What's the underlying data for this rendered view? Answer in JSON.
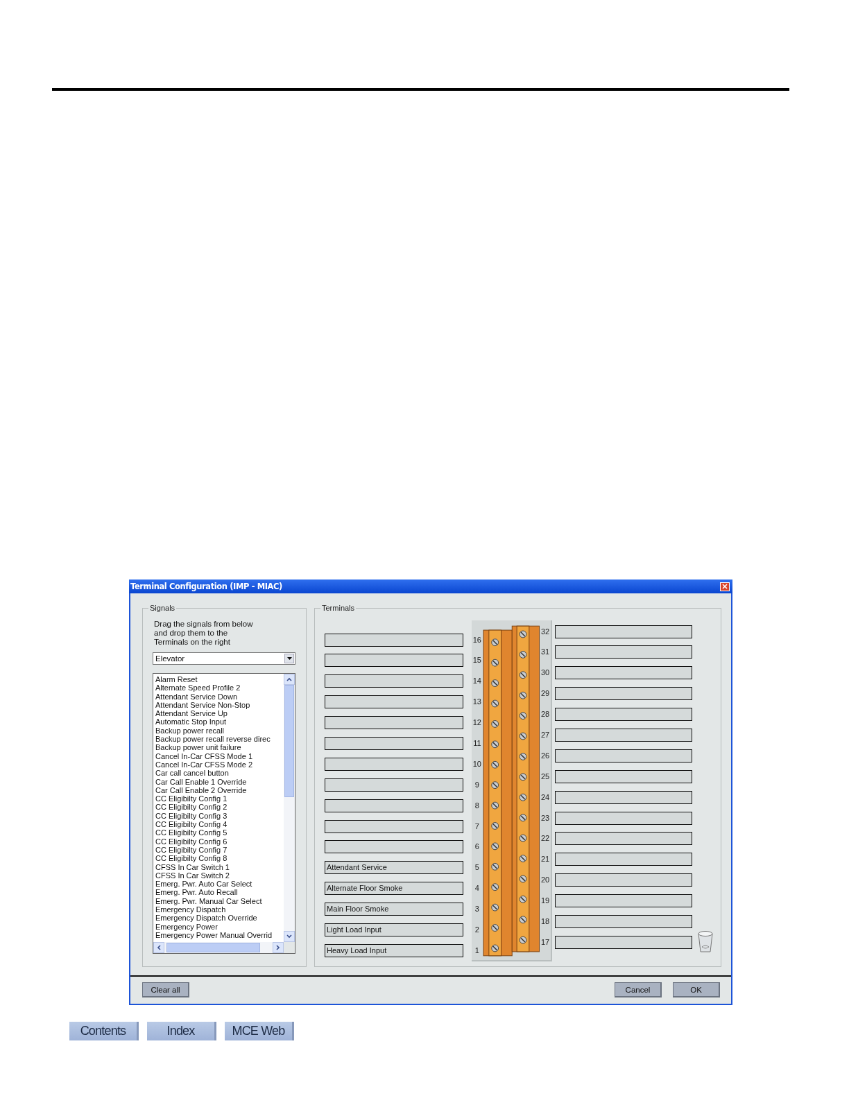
{
  "dialog": {
    "title": "Terminal Configuration (IMP - MIAC)",
    "signals": {
      "legend": "Signals",
      "instructions": "Drag the signals from below and drop them to the Terminals on the right",
      "category": "Elevator",
      "items": [
        "Alarm Reset",
        "Alternate Speed Profile 2",
        "Attendant Service Down",
        "Attendant Service Non-Stop",
        "Attendant Service Up",
        "Automatic Stop Input",
        "Backup power recall",
        "Backup power recall reverse direc",
        "Backup power unit failure",
        "Cancel In-Car CFSS Mode 1",
        "Cancel In-Car CFSS Mode 2",
        "Car call cancel button",
        "Car Call Enable 1 Override",
        "Car Call Enable 2 Override",
        "CC Eligibilty Config 1",
        "CC Eligibilty Config 2",
        "CC Eligibilty Config 3",
        "CC Eligibilty Config 4",
        "CC Eligibilty Config 5",
        "CC Eligibilty Config 6",
        "CC Eligibilty Config 7",
        "CC Eligibilty Config 8",
        "CFSS In Car Switch 1",
        "CFSS In Car Switch 2",
        "Emerg. Pwr. Auto Car Select",
        "Emerg. Pwr. Auto Recall",
        "Emerg. Pwr. Manual Car Select",
        "Emergency Dispatch",
        "Emergency Dispatch Override",
        "Emergency Power",
        "Emergency Power Manual Overrid"
      ]
    },
    "terminals": {
      "legend": "Terminals",
      "left": [
        {
          "number": "16"
        },
        {
          "number": "15"
        },
        {
          "number": "14"
        },
        {
          "number": "13"
        },
        {
          "number": "12"
        },
        {
          "number": "11"
        },
        {
          "number": "10"
        },
        {
          "number": "9"
        },
        {
          "number": "8"
        },
        {
          "number": "7"
        },
        {
          "number": "6"
        },
        {
          "number": "5",
          "signal": "Attendant Service"
        },
        {
          "number": "4",
          "signal": "Alternate Floor Smoke"
        },
        {
          "number": "3",
          "signal": "Main Floor Smoke"
        },
        {
          "number": "2",
          "signal": "Light Load Input"
        },
        {
          "number": "1",
          "signal": "Heavy Load Input"
        }
      ],
      "right": [
        {
          "number": "32"
        },
        {
          "number": "31"
        },
        {
          "number": "30"
        },
        {
          "number": "29"
        },
        {
          "number": "28"
        },
        {
          "number": "27"
        },
        {
          "number": "26"
        },
        {
          "number": "25"
        },
        {
          "number": "24"
        },
        {
          "number": "23"
        },
        {
          "number": "22"
        },
        {
          "number": "21"
        },
        {
          "number": "20"
        },
        {
          "number": "19"
        },
        {
          "number": "18"
        },
        {
          "number": "17"
        }
      ]
    },
    "footer": {
      "left_buttons": [
        "Clear all"
      ],
      "right_buttons": [
        "Cancel",
        "OK"
      ]
    }
  },
  "nav_buttons": [
    "Contents",
    "Index",
    "MCE Web"
  ]
}
